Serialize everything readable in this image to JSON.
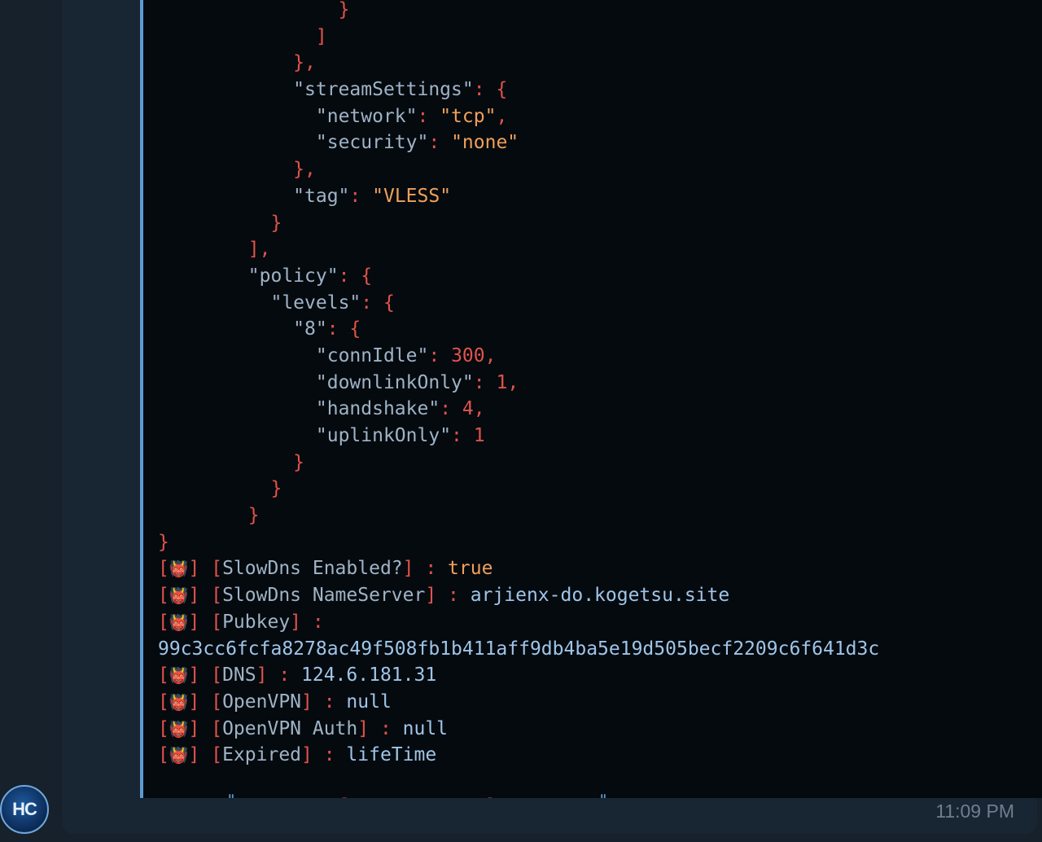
{
  "chat": {
    "avatar_initials": "HC",
    "timestamp": "11:09 PM"
  },
  "emoji": {
    "prefix": "👹"
  },
  "code": {
    "lines": [
      {
        "indent": 16,
        "parts": [
          {
            "t": "}",
            "c": "p"
          }
        ]
      },
      {
        "indent": 14,
        "parts": [
          {
            "t": "]",
            "c": "p"
          }
        ]
      },
      {
        "indent": 12,
        "parts": [
          {
            "t": "},",
            "c": "p"
          }
        ]
      },
      {
        "indent": 12,
        "parts": [
          {
            "t": "\"streamSettings\"",
            "c": "k"
          },
          {
            "t": ": {",
            "c": "p"
          }
        ]
      },
      {
        "indent": 14,
        "parts": [
          {
            "t": "\"network\"",
            "c": "k"
          },
          {
            "t": ": ",
            "c": "p"
          },
          {
            "t": "\"tcp\"",
            "c": "s"
          },
          {
            "t": ",",
            "c": "p"
          }
        ]
      },
      {
        "indent": 14,
        "parts": [
          {
            "t": "\"security\"",
            "c": "k"
          },
          {
            "t": ": ",
            "c": "p"
          },
          {
            "t": "\"none\"",
            "c": "s"
          }
        ]
      },
      {
        "indent": 12,
        "parts": [
          {
            "t": "},",
            "c": "p"
          }
        ]
      },
      {
        "indent": 12,
        "parts": [
          {
            "t": "\"tag\"",
            "c": "k"
          },
          {
            "t": ": ",
            "c": "p"
          },
          {
            "t": "\"VLESS\"",
            "c": "s"
          }
        ]
      },
      {
        "indent": 10,
        "parts": [
          {
            "t": "}",
            "c": "p"
          }
        ]
      },
      {
        "indent": 8,
        "parts": [
          {
            "t": "],",
            "c": "p"
          }
        ]
      },
      {
        "indent": 8,
        "parts": [
          {
            "t": "\"policy\"",
            "c": "k"
          },
          {
            "t": ": {",
            "c": "p"
          }
        ]
      },
      {
        "indent": 10,
        "parts": [
          {
            "t": "\"levels\"",
            "c": "k"
          },
          {
            "t": ": {",
            "c": "p"
          }
        ]
      },
      {
        "indent": 12,
        "parts": [
          {
            "t": "\"8\"",
            "c": "k"
          },
          {
            "t": ": {",
            "c": "p"
          }
        ]
      },
      {
        "indent": 14,
        "parts": [
          {
            "t": "\"connIdle\"",
            "c": "k"
          },
          {
            "t": ": ",
            "c": "p"
          },
          {
            "t": "300",
            "c": "n"
          },
          {
            "t": ",",
            "c": "p"
          }
        ]
      },
      {
        "indent": 14,
        "parts": [
          {
            "t": "\"downlinkOnly\"",
            "c": "k"
          },
          {
            "t": ": ",
            "c": "p"
          },
          {
            "t": "1",
            "c": "n"
          },
          {
            "t": ",",
            "c": "p"
          }
        ]
      },
      {
        "indent": 14,
        "parts": [
          {
            "t": "\"handshake\"",
            "c": "k"
          },
          {
            "t": ": ",
            "c": "p"
          },
          {
            "t": "4",
            "c": "n"
          },
          {
            "t": ",",
            "c": "p"
          }
        ]
      },
      {
        "indent": 14,
        "parts": [
          {
            "t": "\"uplinkOnly\"",
            "c": "k"
          },
          {
            "t": ": ",
            "c": "p"
          },
          {
            "t": "1",
            "c": "n"
          }
        ]
      },
      {
        "indent": 12,
        "parts": [
          {
            "t": "}",
            "c": "p"
          }
        ]
      },
      {
        "indent": 10,
        "parts": [
          {
            "t": "}",
            "c": "p"
          }
        ]
      },
      {
        "indent": 8,
        "parts": [
          {
            "t": "}",
            "c": "p"
          }
        ]
      },
      {
        "indent": 0,
        "parts": [
          {
            "t": "}",
            "c": "p"
          }
        ]
      }
    ],
    "info_rows": [
      {
        "label": "SlowDns Enabled?",
        "value": "true",
        "vc": "m"
      },
      {
        "label": "SlowDns NameServer",
        "value": "arjienx-do.kogetsu.site",
        "vc": "w"
      },
      {
        "label": "Pubkey",
        "value": "",
        "vc": "w"
      },
      {
        "raw": "99c3cc6fcfa8278ac49f508fb1b411aff9db4ba5e19d505becf2209c6f641d3c",
        "vc": "w"
      },
      {
        "label": "DNS",
        "value": "124.6.181.31",
        "vc": "w"
      },
      {
        "label": "OpenVPN",
        "value": "null",
        "vc": "w"
      },
      {
        "label": "OpenVPN Auth",
        "value": "null",
        "vc": "w"
      },
      {
        "label": "Expired",
        "value": "lifeTime",
        "vc": "w"
      }
    ],
    "separator": {
      "left_rule": "╚═════════",
      "open": "[ ",
      "ornament": "• •✠•❀•✠• •",
      "close": "]",
      "right_rule": "═════════╝"
    }
  },
  "colors": {
    "background": "#17212b",
    "bubble": "#182533",
    "code_background": "#050a0f",
    "accent_bar": "#5c9bd1",
    "punct": "#e0534a",
    "key": "#9fb3c6",
    "string": "#f0a05a",
    "info_value": "#9fc5e8",
    "timestamp": "#6d7f8f"
  }
}
